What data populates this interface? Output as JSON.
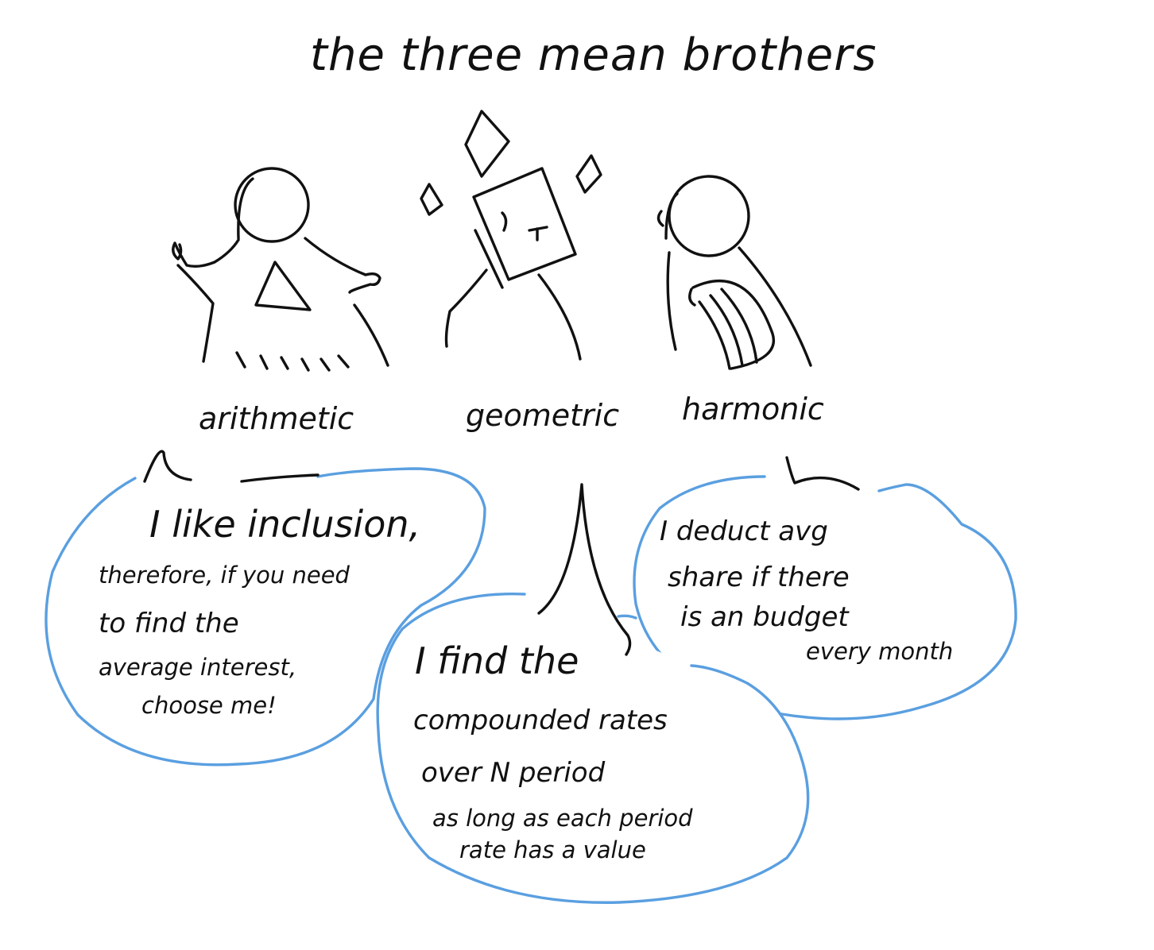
{
  "colors": {
    "ink": "#111111",
    "bubble_outline": "#5a9fe0",
    "background": "#ffffff"
  },
  "title": "the three mean brothers",
  "figures": [
    {
      "label": "arithmetic",
      "speech": [
        "I like inclusion,",
        "therefore, if you need",
        "to find the",
        "average interest,",
        "choose me!"
      ]
    },
    {
      "label": "geometric",
      "speech": [
        "I find the",
        "compounded rates",
        "over N period",
        "as long as each period",
        "rate has a value"
      ]
    },
    {
      "label": "harmonic",
      "speech": [
        "I deduct avg",
        "share if there",
        "is an budget",
        "every month"
      ]
    }
  ]
}
